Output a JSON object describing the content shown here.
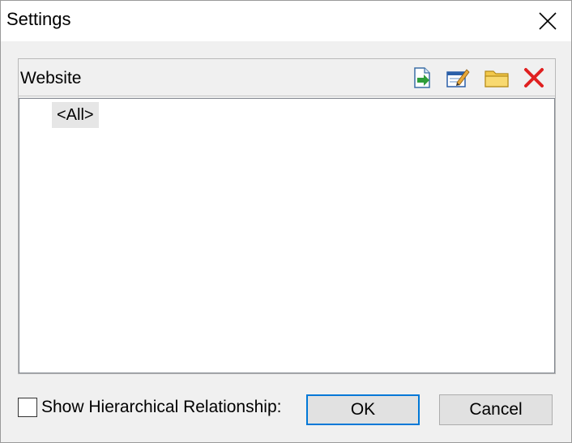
{
  "window": {
    "title": "Settings"
  },
  "panel": {
    "label": "Website",
    "toolbar": [
      {
        "icon": "import-icon"
      },
      {
        "icon": "edit-icon"
      },
      {
        "icon": "folder-icon"
      },
      {
        "icon": "delete-icon"
      }
    ],
    "items": [
      {
        "label": "<All>"
      }
    ]
  },
  "options": {
    "show_hierarchical_label": "Show Hierarchical Relationship:",
    "show_hierarchical_checked": false
  },
  "buttons": {
    "ok_label": "OK",
    "cancel_label": "Cancel"
  },
  "colors": {
    "accent": "#0078d7",
    "delete": "#e02020",
    "folder": "#f2c84b"
  }
}
